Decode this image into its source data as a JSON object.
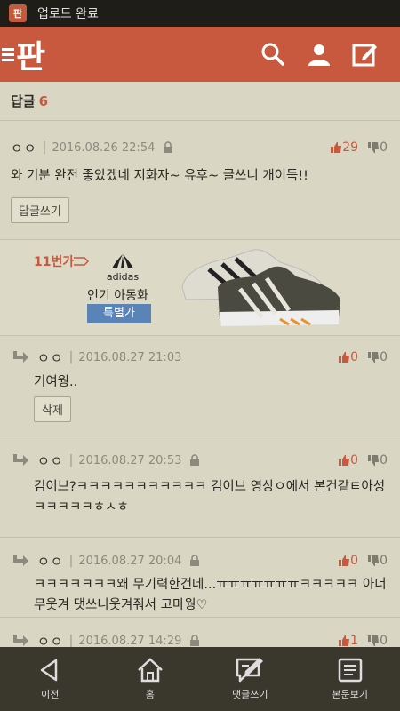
{
  "status": {
    "notification_text": "업로드 완료",
    "app_icon_glyph": "판"
  },
  "appbar": {
    "logo": "판",
    "bg_color": "#c8583e"
  },
  "reply_header": {
    "label": "답글",
    "count": "6"
  },
  "comments": [
    {
      "author": "ㅇㅇ",
      "date": "2016.08.26 22:54",
      "locked": true,
      "up": "29",
      "down": "0",
      "body": "와 기분 완전 좋았겠네 지화자~ 유후~ 글쓰니 개이득!!",
      "action": "답글쓰기"
    },
    {
      "author": "ㅇㅇ",
      "date": "2016.08.27 21:03",
      "locked": false,
      "up": "0",
      "down": "0",
      "body": "기여웡..",
      "action": "삭제"
    },
    {
      "author": "ㅇㅇ",
      "date": "2016.08.27 20:53",
      "locked": true,
      "up": "0",
      "down": "0",
      "body": "김이브?ㅋㅋㅋㅋㅋㅋㅋㅋㅋㅋㅋ 김이브 영상ㅇ에서 본건같ㅌ아성 ㅋㅋㅋㅋㅋㅎㅅㅎ"
    },
    {
      "author": "ㅇㅇ",
      "date": "2016.08.27 20:04",
      "locked": true,
      "up": "0",
      "down": "0",
      "body": "ㅋㅋㅋㅋㅋㅋㅋ왜 무기력한건데...ㅠㅠㅠㅠㅠㅠㅠㅋㅋㅋㅋㅋ 아너무웃겨 댓쓰니웃겨줘서 고마웡♡"
    },
    {
      "author": "ㅇㅇ",
      "date": "2016.08.27 14:29",
      "locked": true,
      "up": "1",
      "down": "0"
    }
  ],
  "ad": {
    "shop_logo": "11번가",
    "brand": "adidas",
    "title": "인기 아동화",
    "badge": "특별가"
  },
  "bottom_nav": [
    {
      "label": "이전",
      "icon": "back-icon"
    },
    {
      "label": "홈",
      "icon": "home-icon"
    },
    {
      "label": "댓글쓰기",
      "icon": "write-comment-icon"
    },
    {
      "label": "본문보기",
      "icon": "view-article-icon"
    }
  ]
}
